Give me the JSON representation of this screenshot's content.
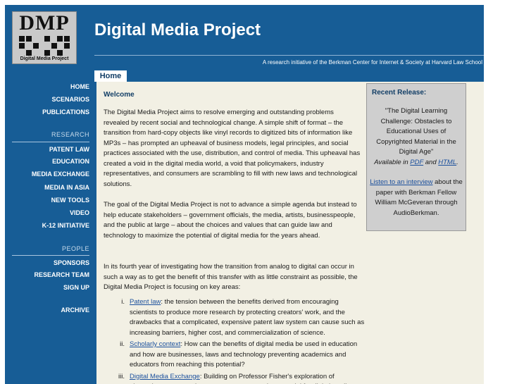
{
  "logo": {
    "text": "DMP",
    "subtitle": "Digital Media Project"
  },
  "header": {
    "title": "Digital Media Project",
    "tagline": "A research initiative of the Berkman Center for Internet & Society at Harvard Law School"
  },
  "tabs": [
    {
      "label": "Home",
      "active": true
    }
  ],
  "sidebar": {
    "top_items": [
      "HOME",
      "SCENARIOS",
      "PUBLICATIONS"
    ],
    "research_heading": "RESEARCH",
    "research_items": [
      "PATENT LAW",
      "EDUCATION",
      "MEDIA EXCHANGE",
      "MEDIA IN ASIA",
      "NEW TOOLS",
      "VIDEO",
      "K-12 INITIATIVE"
    ],
    "people_heading": "PEOPLE",
    "people_items": [
      "SPONSORS",
      "RESEARCH TEAM",
      "SIGN UP"
    ],
    "archive": "ARCHIVE"
  },
  "content": {
    "heading": "Welcome",
    "p1": "The Digital Media Project aims to resolve emerging and outstanding problems revealed by recent social and technological change. A simple shift of format – the transition from hard-copy objects like vinyl records to digitized bits of information like MP3s – has prompted an upheaval of business models, legal principles, and social practices associated with the use, distribution, and control of media. This upheaval has created a void in the digital media world, a void that policymakers, industry representatives, and consumers are scrambling to fill with new laws and technological solutions.",
    "p2": "The goal of the Digital Media Project is not to advance a simple agenda but instead to help educate stakeholders – government officials, the media, artists, businesspeople, and the public at large – about the choices and values that can guide law and technology to maximize the potential of digital media for the years ahead.",
    "p3": "In its fourth year of investigating how the transition from analog to digital can occur in such a way as to get the benefit of this transfer with as little constraint as possible, the Digital Media Project is focusing on key areas:",
    "list": [
      {
        "num": "i.",
        "link": "Patent law",
        "text": ": the tension between the benefits derived from encouraging scientists to produce more research by protecting creators' work, and the drawbacks that a complicated, expensive patent law system can cause such as increasing barriers, higher cost, and commercialization of science."
      },
      {
        "num": "ii.",
        "link": "Scholarly context",
        "text": ": How can the benefits of digital media be used in education and how are businesses, laws and technology preventing academics and educators from reaching this potential?"
      },
      {
        "num": "iii.",
        "link": "Digital Media Exchange",
        "text": ": Building on Professor Fisher's exploration of alternative compensation systems, we are testing a model for digital media"
      }
    ]
  },
  "release": {
    "heading": "Recent Release:",
    "title": "\"The Digital Learning Challenge: Obstacles to Educational Uses of Copyrighted Material in the Digital Age\"",
    "available_prefix": "Available in ",
    "pdf": "PDF",
    "and": " and ",
    "html": "HTML",
    "period": ".",
    "listen_link": "Listen to an interview",
    "listen_text": " about the paper with Berkman Fellow William McGeveran through AudioBerkman."
  },
  "colors": {
    "frame": "#175d96",
    "content_bg": "#f2f0e4",
    "heading": "#123e66",
    "link": "#1a4f9c",
    "release_bg": "#cfcfcf"
  }
}
